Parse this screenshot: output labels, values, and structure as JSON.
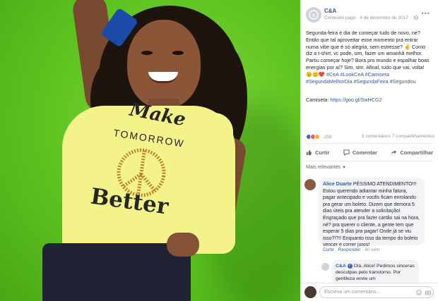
{
  "page": {
    "name": "C&A",
    "meta": "Conteúdo pago · 4 de dezembro de 2017 ·"
  },
  "shirt": {
    "line1": "Make",
    "line2": "TOMORROW",
    "line3": "Better"
  },
  "post": {
    "body": "Segunda-feira é dia de começar tudo de novo, né? Então que tal aproveitar esse momento pra entrar numa vibe que é só alegria, sem estresse? ✌ Como diz a t-shirt, vc pode, sim, fazer um amanhã melhor. Partiu começar hoje? Bora pro mundo e espalhar boas energias por aí? Sim, sim. Afinal, tudo que vai, volta! 😉😊❤️",
    "tags": "#CeA #LookCeA #Camiseta #SegundaMelhorDia #SegundaFeira #Segundou",
    "camiseta_label": "Camiseta:",
    "camiseta_link": "https://goo.gl/SwHCG2"
  },
  "stats": {
    "reactions": "258",
    "comments": "5 comentários",
    "shares": "7 compartilhamentos"
  },
  "actions": {
    "like": "Curtir",
    "comment": "Comentar",
    "share": "Compartilhar"
  },
  "filter": {
    "label": "Mais relevantes"
  },
  "comments": [
    {
      "author": "Alice Duarte",
      "text": "PÉSSIMO ATENDIMENTO!!! Estou querendo adiantar minha fatura, pagar antecipado e vocês ficam enrolando pra gerar um boleto. Dizem que demora 5 dias úteis pra atender a solicitação! Engraçado que pra fazer cartão sai na hora, né? pra querer o cliente, a gente tem que esperar 5 dias pra pagar! Onde já se viu isso?!?!! Enquanto isso da tempo do boleto vencer e correr juros!",
      "like": "Curtir",
      "reply": "Responder",
      "time": "· 40 sem"
    }
  ],
  "reply": {
    "author": "C&A",
    "text": "Olá, Alice! Pedimos sinceras desculpas pelo transtorno. Por gentileza envie um"
  },
  "composer": {
    "placeholder": "Escreva um comentário..."
  },
  "colors": {
    "link": "#365899",
    "green": "#5cc21f",
    "shirt": "#f4f38a"
  }
}
